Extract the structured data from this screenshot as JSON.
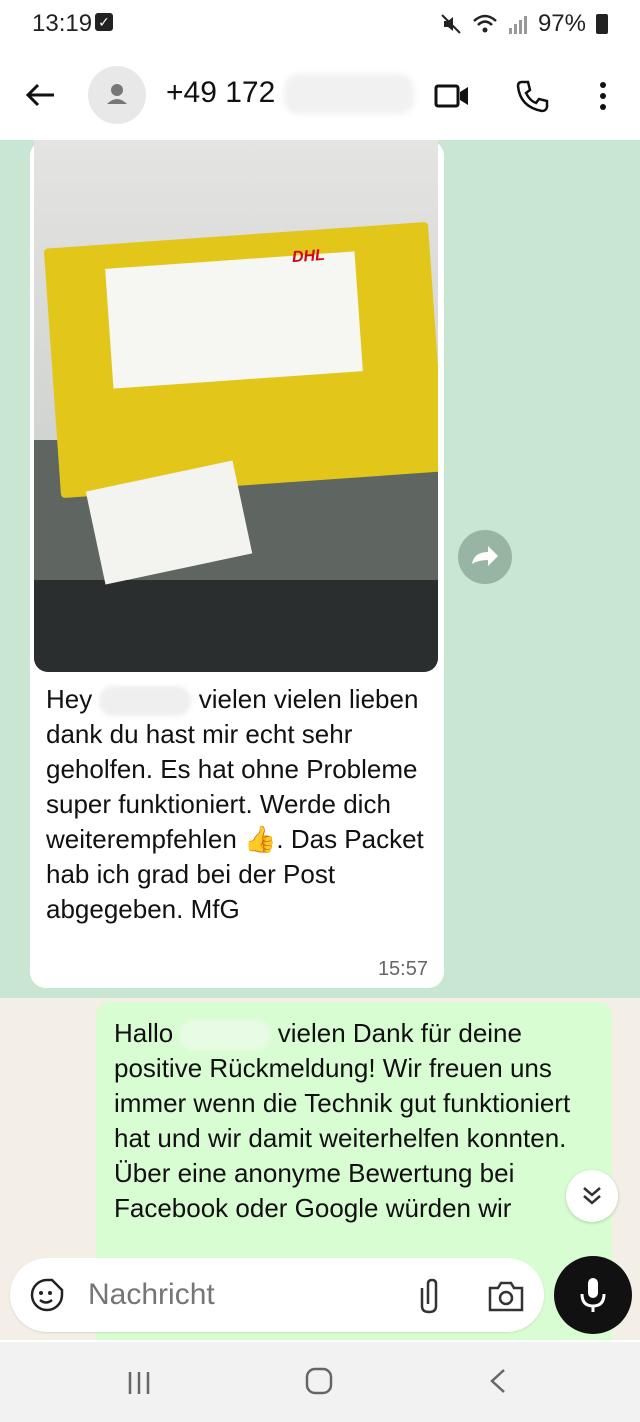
{
  "status_bar": {
    "time": "13:19",
    "battery": "97%",
    "icons": [
      "check-icon",
      "mute-icon",
      "wifi-icon",
      "signal-icon",
      "battery-icon"
    ]
  },
  "header": {
    "contact": "+49 172",
    "icons": [
      "back-arrow-icon",
      "avatar-icon",
      "video-call-icon",
      "voice-call-icon",
      "more-vert-icon"
    ]
  },
  "incoming": {
    "image_label": "DHL",
    "text_prefix": "Hey",
    "text_rest": "vielen vielen lieben dank du hast mir echt sehr geholfen. Es hat ohne Probleme super funktioniert. Werde dich weiterempfehlen",
    "emoji": "👍",
    "text_end": ". Das Packet hab ich grad bei der Post abgegeben. MfG",
    "time": "15:57"
  },
  "outgoing": {
    "text_prefix": "Hallo",
    "text_rest": "vielen Dank für deine positive Rückmeldung! Wir freuen uns immer wenn die Technik gut funktioniert hat und wir damit weiterhelfen konnten.",
    "text_line2": "Über eine anonyme Bewertung bei Facebook oder Google würden wir"
  },
  "composer": {
    "placeholder": "Nachricht"
  },
  "colors": {
    "chat_green": "#c9e6d2",
    "chat_cream": "#f3efe6",
    "outgoing_bubble": "#d9fdd3"
  }
}
